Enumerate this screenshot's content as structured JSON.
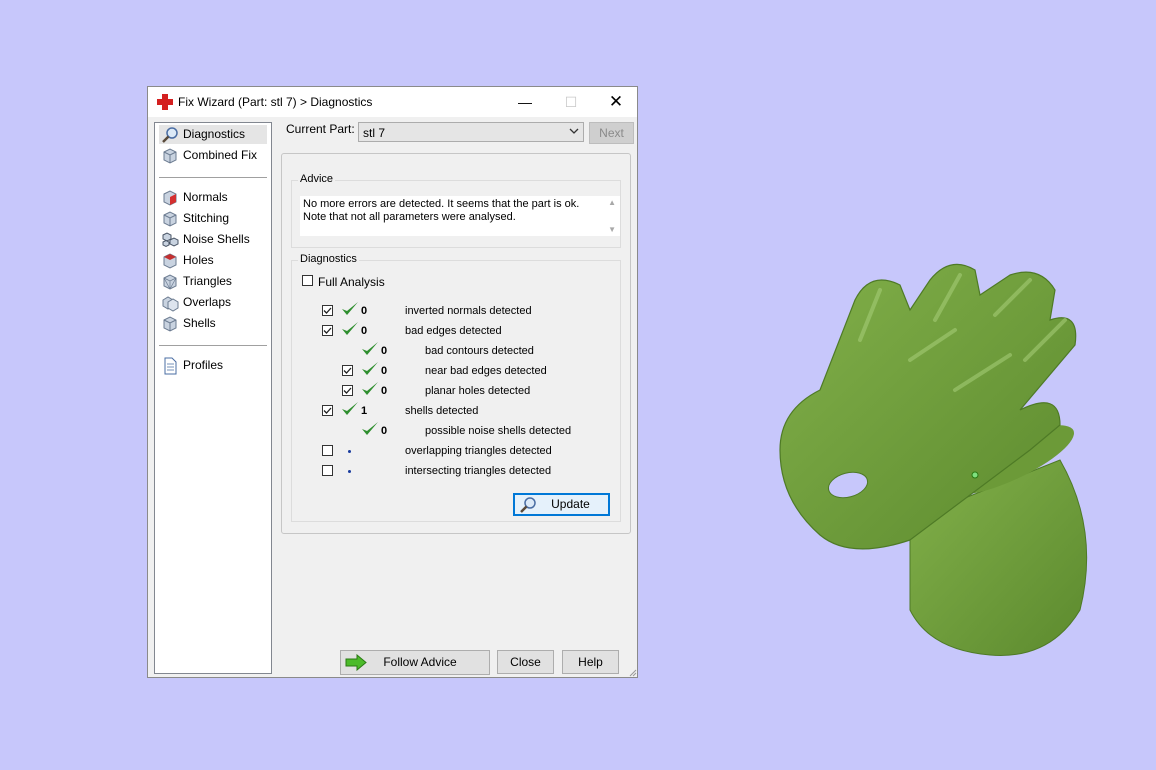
{
  "window": {
    "title": "Fix Wizard (Part: stl 7) > Diagnostics",
    "minimize_glyph": "—",
    "maximize_glyph": "☐",
    "close_glyph": "✕"
  },
  "sidebar": {
    "items": [
      {
        "label": "Diagnostics",
        "icon": "magnifier-icon",
        "selected": true
      },
      {
        "label": "Combined Fix",
        "icon": "cube-icon"
      },
      {
        "label": "Normals",
        "icon": "normals-cube-icon"
      },
      {
        "label": "Stitching",
        "icon": "stitching-cube-icon"
      },
      {
        "label": "Noise Shells",
        "icon": "noise-shells-icon"
      },
      {
        "label": "Holes",
        "icon": "holes-cube-icon"
      },
      {
        "label": "Triangles",
        "icon": "triangles-cube-icon"
      },
      {
        "label": "Overlaps",
        "icon": "overlaps-icon"
      },
      {
        "label": "Shells",
        "icon": "shells-cube-icon"
      },
      {
        "label": "Profiles",
        "icon": "document-icon"
      }
    ]
  },
  "header": {
    "current_part_label": "Current Part:",
    "current_part_value": "stl 7",
    "next_label": "Next"
  },
  "advice": {
    "title": "Advice",
    "text": "No more errors are detected. It seems that the part is ok. Note that not all parameters were analysed.",
    "scroll_up": "▲",
    "scroll_down": "▼"
  },
  "diagnostics": {
    "title": "Diagnostics",
    "full_analysis_label": "Full Analysis",
    "rows": [
      {
        "count": "0",
        "label": "inverted normals detected"
      },
      {
        "count": "0",
        "label": "bad edges detected"
      },
      {
        "count": "0",
        "label": "bad contours detected"
      },
      {
        "count": "0",
        "label": "near bad edges detected"
      },
      {
        "count": "0",
        "label": "planar holes detected"
      },
      {
        "count": "1",
        "label": "shells detected"
      },
      {
        "count": "0",
        "label": "possible noise shells detected"
      },
      {
        "count": "",
        "label": "overlapping triangles detected"
      },
      {
        "count": "",
        "label": "intersecting triangles detected"
      }
    ],
    "update_label": "Update"
  },
  "footer": {
    "follow_advice_label": "Follow Advice",
    "close_label": "Close",
    "help_label": "Help"
  },
  "colors": {
    "background": "#c7c7fb",
    "model_green": "#6f9c3c",
    "check_green": "#2f8f2f",
    "accent_blue": "#0078d7"
  }
}
